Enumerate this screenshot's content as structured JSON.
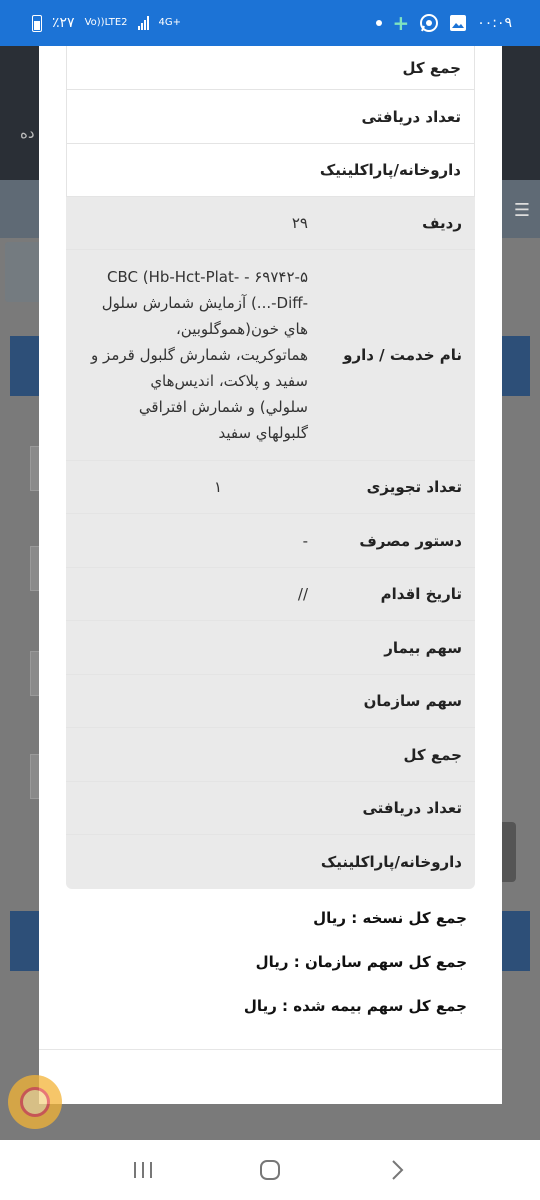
{
  "status_bar": {
    "time": "۰۰:۰۹",
    "battery": "٪۲۷",
    "network_volte": "Vo))",
    "network_lte": "LTE2",
    "network_4g": "4G+"
  },
  "background": {
    "header_fragment": "ده"
  },
  "table": {
    "top_rows": [
      {
        "label": "جمع کل"
      },
      {
        "label": "تعداد دریافتی"
      },
      {
        "label": "داروخانه/پاراکلینیک"
      }
    ],
    "record": [
      {
        "label": "ردیف",
        "value": "۲۹"
      },
      {
        "label": "نام خدمت / دارو",
        "value": "CBC (Hb-Hct-Plat- - ۶۹۷۴۲-۵\n-Diff-...) آزمایش شمارش سلول\nهاي خون(هموگلوبين،\nهماتوکريت، شمارش گلبول قرمز و\nسفيد و پلاکت، انديس‌هاي\nسلولي) و شمارش افتراقي\nگلبولهاي سفيد"
      },
      {
        "label": "تعداد تجویزی",
        "value": "۱"
      },
      {
        "label": "دستور مصرف",
        "value": "-"
      },
      {
        "label": "تاریخ اقدام",
        "value": "//"
      },
      {
        "label": "سهم بیمار",
        "value": ""
      },
      {
        "label": "سهم سازمان",
        "value": ""
      },
      {
        "label": "جمع کل",
        "value": ""
      },
      {
        "label": "تعداد دریافتی",
        "value": ""
      },
      {
        "label": "داروخانه/پاراکلینیک",
        "value": ""
      }
    ]
  },
  "totals": {
    "prescription_total": "جمع کل نسخه : ریال",
    "organization_share_total": "جمع کل سهم سازمان : ریال",
    "insured_share_total": "جمع کل سهم بیمه شده : ریال"
  },
  "colors": {
    "status_bar": "#1c73d6",
    "row_gray": "#eaeaea",
    "accent_fab": "#f3b437"
  },
  "icons": [
    "battery-icon",
    "signal-icon",
    "dot-icon",
    "plus-icon",
    "whatsapp-icon",
    "gallery-icon",
    "recent-apps-icon",
    "home-icon",
    "back-icon"
  ]
}
